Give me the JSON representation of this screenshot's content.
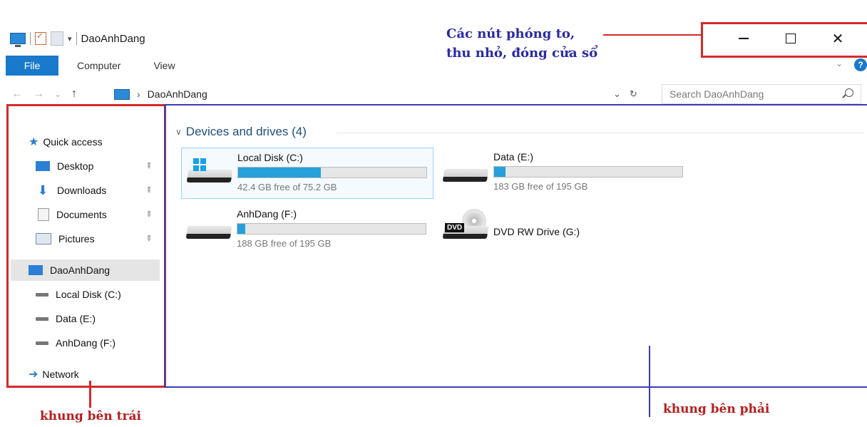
{
  "title_bar": {
    "title": "DaoAnhDang",
    "qat_dropdown": "▾"
  },
  "window_buttons": {
    "minimize": "–",
    "maximize": "",
    "close": "✕"
  },
  "ribbon": {
    "tabs": [
      {
        "label": "File"
      },
      {
        "label": "Computer"
      },
      {
        "label": "View"
      }
    ],
    "help": "?"
  },
  "nav": {
    "back": "←",
    "forward": "→",
    "recent": "⌄",
    "up": "↑"
  },
  "address": {
    "crumb": "DaoAnhDang",
    "dropdown": "⌄",
    "refresh": "↻"
  },
  "search": {
    "placeholder": "Search DaoAnhDang"
  },
  "sidebar": {
    "quick_access": "Quick access",
    "quick_items": [
      {
        "label": "Desktop",
        "icon": "desktop-icon"
      },
      {
        "label": "Downloads",
        "icon": "downloads-icon"
      },
      {
        "label": "Documents",
        "icon": "documents-icon"
      },
      {
        "label": "Pictures",
        "icon": "pictures-icon"
      }
    ],
    "this_pc": "DaoAnhDang",
    "drives": [
      {
        "label": "Local Disk (C:)"
      },
      {
        "label": "Data (E:)"
      },
      {
        "label": "AnhDang (F:)"
      }
    ],
    "network": "Network"
  },
  "content": {
    "group_title": "Devices and drives (4)",
    "drives": [
      {
        "name": "Local Disk (C:)",
        "free": "42.4 GB free of 75.2 GB",
        "used_fraction": 0.44
      },
      {
        "name": "Data (E:)",
        "free": "183 GB free of 195 GB",
        "used_fraction": 0.06
      },
      {
        "name": "AnhDang (F:)",
        "free": "188 GB free of 195 GB",
        "used_fraction": 0.04
      },
      {
        "name": "DVD RW Drive (G:)",
        "dvd_label": "DVD"
      }
    ]
  },
  "annotations": {
    "buttons_line1": "Các nút phóng to,",
    "buttons_line2": "thu nhỏ, đóng cửa sổ",
    "left_pane": "khung bên trái",
    "right_pane": "khung bên phải"
  },
  "colors": {
    "accent": "#1979ca",
    "annotation_red": "#d32a2a",
    "annotation_blue": "#3b3bb5",
    "bar_fill": "#26a0da"
  }
}
